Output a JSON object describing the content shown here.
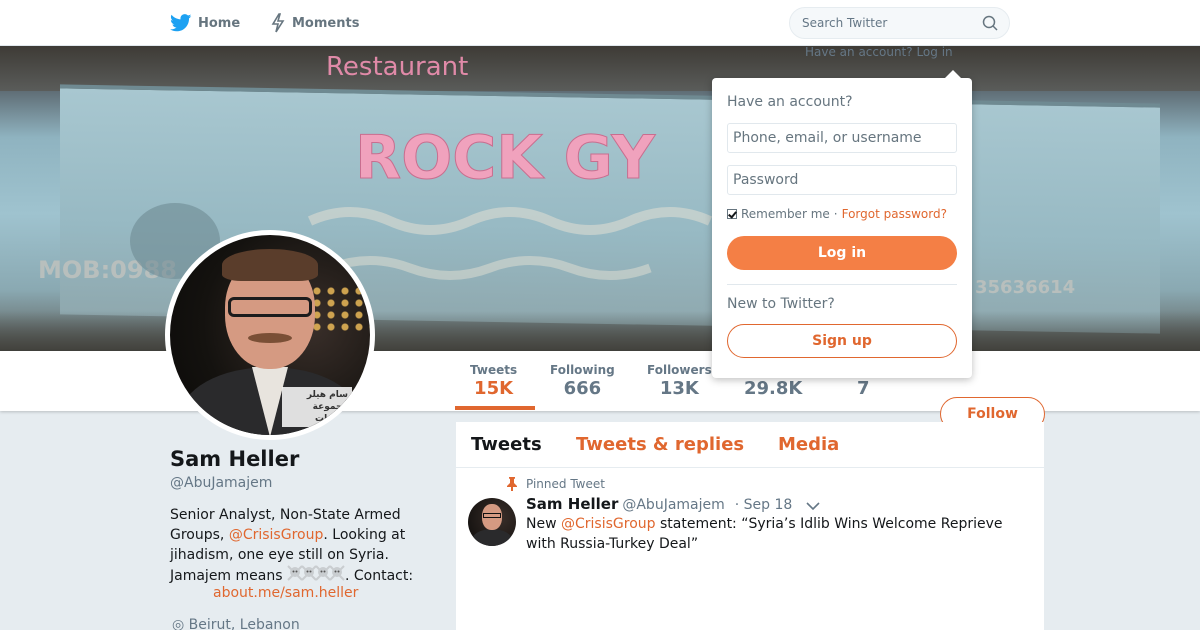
{
  "nav": {
    "home_label": "Home",
    "moments_label": "Moments",
    "search_placeholder": "Search Twitter"
  },
  "login_header": {
    "text": "Have an account?",
    "login_link": "Log in"
  },
  "login_dropdown": {
    "title": "Have an account?",
    "username_placeholder": "Phone, email, or username",
    "password_placeholder": "Password",
    "remember_label": "Remember me",
    "separator": "·",
    "forgot_label": "Forgot password?",
    "login_button": "Log in",
    "new_label": "New to Twitter?",
    "signup_button": "Sign up",
    "remember_checked": true
  },
  "profile": {
    "name": "Sam Heller",
    "handle": "@AbuJamajem",
    "bio_part1": "Senior Analyst, Non-State Armed Groups, ",
    "bio_mention": "@CrisisGroup",
    "bio_part2": ". Looking at jihadism, one eye still on Syria. Jamajem means ",
    "bio_part3": ". Contact:",
    "contact_link": "about.me/sam.heller",
    "location": "Beirut, Lebanon",
    "avatar_caption_line1": "سام هيلر",
    "avatar_caption_line2": "مجموعة الأزمات"
  },
  "stats": [
    {
      "label": "Tweets",
      "value": "15K",
      "active": true
    },
    {
      "label": "Following",
      "value": "666",
      "active": false
    },
    {
      "label": "Followers",
      "value": "13K",
      "active": false
    },
    {
      "label": "",
      "value": "29.8K",
      "active": false
    },
    {
      "label": "",
      "value": "7",
      "active": false
    }
  ],
  "follow_button": "Follow",
  "timeline": {
    "tabs": [
      "Tweets",
      "Tweets & replies",
      "Media"
    ],
    "pinned_label": "Pinned Tweet",
    "tweet": {
      "name": "Sam Heller",
      "handle": "@AbuJamajem",
      "date": "· Sep 18",
      "text_prefix": "New ",
      "text_mention": "@CrisisGroup",
      "text_suffix": " statement: “Syria’s Idlib Wins Welcome Reprieve with Russia-Turkey Deal”"
    }
  },
  "banner": {
    "text_restaurant": "Restaurant",
    "text_sign": "ROCK GY",
    "text_mob": "MOB:0988",
    "text_phone": "35636614"
  },
  "colors": {
    "accent": "#e0672f",
    "button_fill": "#f47f45",
    "twitter_blue": "#1da1f2"
  }
}
